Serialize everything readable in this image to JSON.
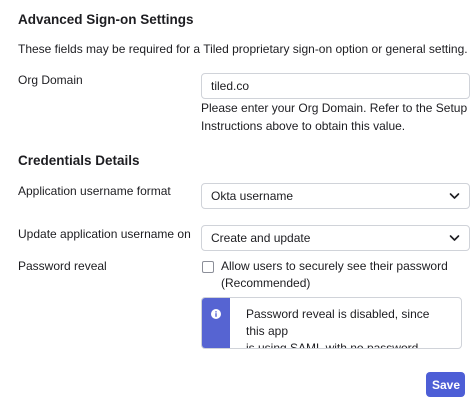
{
  "advanced": {
    "title": "Advanced Sign-on Settings",
    "description": "These fields may be required for a Tiled proprietary sign-on option or general setting."
  },
  "org_domain": {
    "label": "Org Domain",
    "value": "tiled.co",
    "help_line1": "Please enter your Org Domain. Refer to the Setup",
    "help_line2": "Instructions above to obtain this value."
  },
  "credentials": {
    "title": "Credentials Details",
    "username_format_label": "Application username format",
    "username_format_value": "Okta username",
    "update_label": "Update application username on",
    "update_value": "Create and update",
    "password_reveal_label": "Password reveal",
    "checkbox_line1": "Allow users to securely see their password",
    "checkbox_line2": "(Recommended)",
    "notice_line1": "Password reveal is disabled, since this app",
    "notice_line2": "is using SAML with no password."
  },
  "footer": {
    "save_label": "Save"
  },
  "colors": {
    "accent": "#4d5ed6",
    "notice_bar": "#5664d2"
  },
  "icons": {
    "select_chevron": "chevron-down-icon",
    "notice": "info-icon"
  }
}
